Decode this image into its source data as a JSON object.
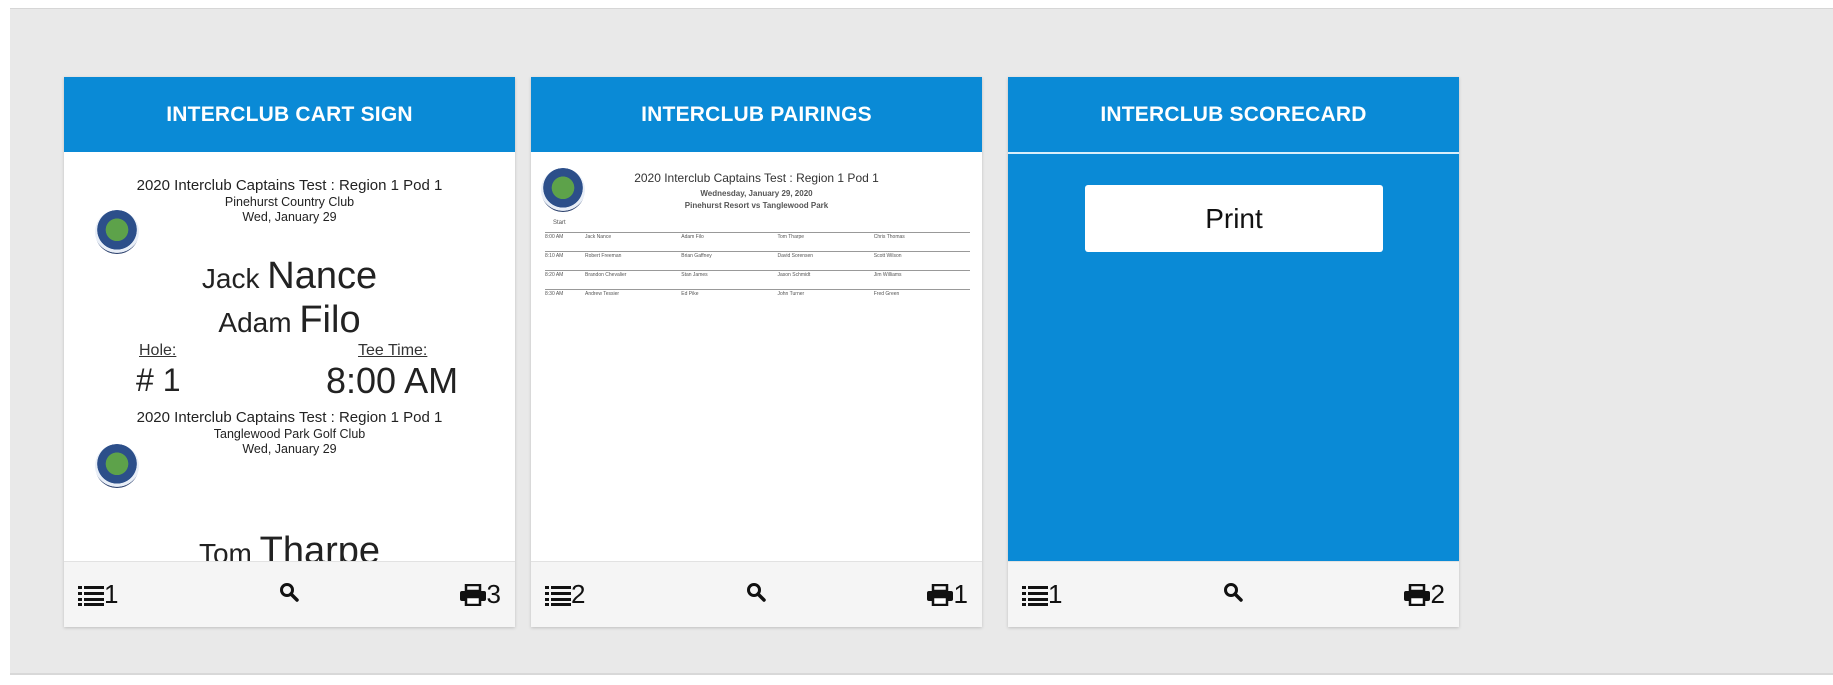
{
  "cards": [
    {
      "title": "INTERCLUB CART SIGN",
      "preview": {
        "block1": {
          "event": "2020 Interclub Captains Test : Region 1 Pod 1",
          "club": "Pinehurst Country Club",
          "date": "Wed, January 29",
          "player1_first": "Jack",
          "player1_last": "Nance",
          "player2_first": "Adam",
          "player2_last": "Filo",
          "hole_label": "Hole:",
          "hole_value": "# 1",
          "tee_label": "Tee Time:",
          "tee_value": "8:00 AM"
        },
        "block2": {
          "event": "2020 Interclub Captains Test : Region 1 Pod 1",
          "club": "Tanglewood Park Golf Club",
          "date": "Wed, January 29",
          "player1_first": "Tom",
          "player1_last": "Tharpe"
        }
      },
      "footer": {
        "list_count": "1",
        "print_count": "3"
      }
    },
    {
      "title": "INTERCLUB PAIRINGS",
      "preview": {
        "title": "2020 Interclub Captains Test : Region 1 Pod 1",
        "subtitle1": "Wednesday, January 29, 2020",
        "subtitle2": "Pinehurst Resort vs Tanglewood Park",
        "start_label": "Start",
        "rows": [
          [
            "8:00 AM",
            "Jack Nance",
            "Adam Filo",
            "Tom Tharpe",
            "Chris Thomas"
          ],
          [
            "8:10 AM",
            "Robert Freeman",
            "Brian Gaffney",
            "David Sorensen",
            "Scott Wilson"
          ],
          [
            "8:20 AM",
            "Brandon Chevalier",
            "Stan James",
            "Jason Schmidt",
            "Jim Williams"
          ],
          [
            "8:30 AM",
            "Andrew Tessier",
            "Ed Pike",
            "John Turner",
            "Fred Green"
          ]
        ]
      },
      "footer": {
        "list_count": "2",
        "print_count": "1"
      }
    },
    {
      "title": "INTERCLUB SCORECARD",
      "preview": {
        "button_label": "Print"
      },
      "footer": {
        "list_count": "1",
        "print_count": "2"
      }
    }
  ],
  "icons": {
    "list": "list-icon",
    "search": "search-icon",
    "print": "print-icon"
  },
  "colors": {
    "header": "#0a8ad6",
    "panel": "#e9e9e9",
    "footer": "#f5f5f5"
  }
}
